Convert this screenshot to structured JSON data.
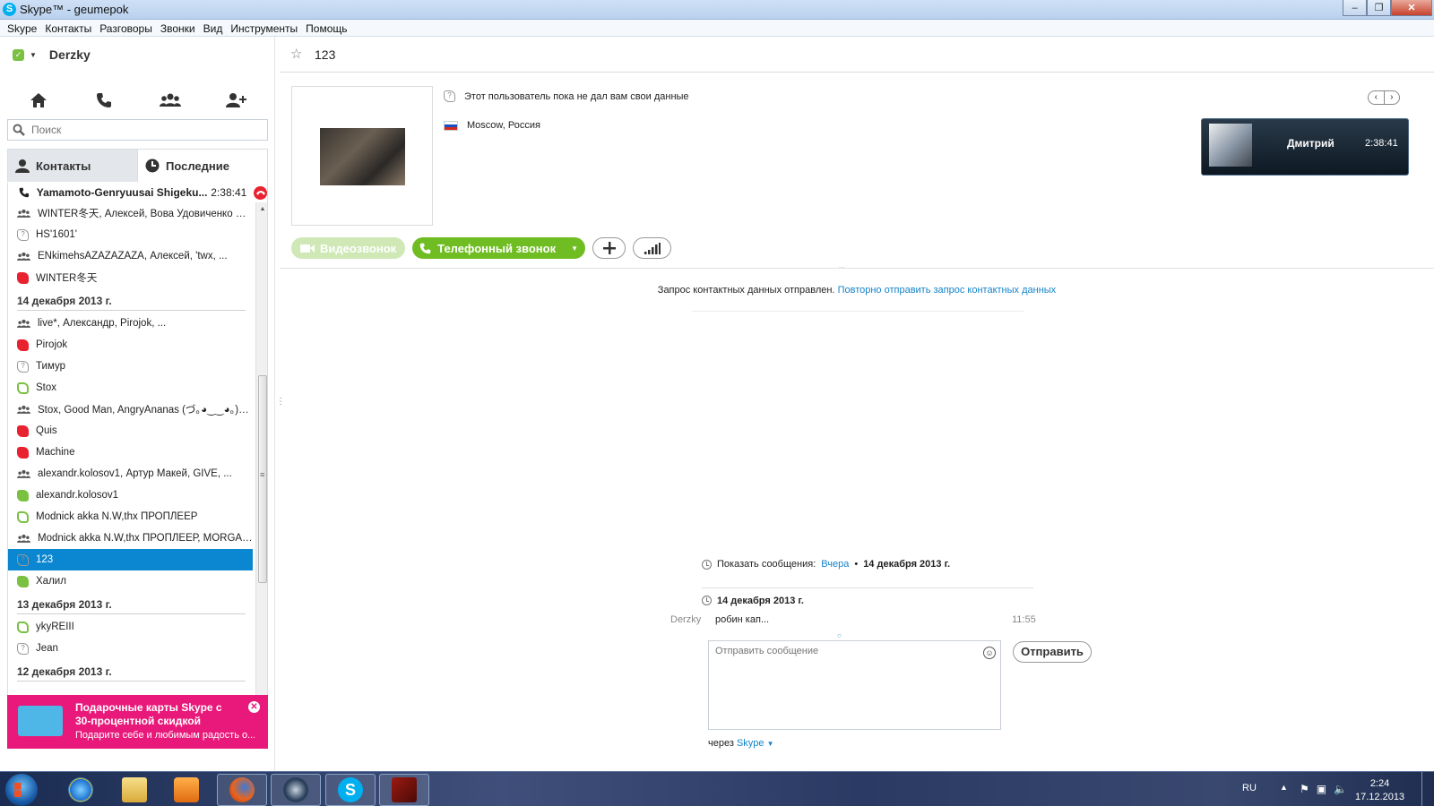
{
  "window": {
    "title": "Skype™ - geumepok",
    "min": "–",
    "max": "❐",
    "close": "✕"
  },
  "menu": [
    "Skype",
    "Контакты",
    "Разговоры",
    "Звонки",
    "Вид",
    "Инструменты",
    "Помощь"
  ],
  "profile": {
    "name": "Derzky"
  },
  "search": {
    "placeholder": "Поиск"
  },
  "tabs": {
    "contacts": "Контакты",
    "recent": "Последние"
  },
  "active_call": {
    "name": "Yamamoto-Genryuusai Shigeku...",
    "time": "2:38:41"
  },
  "recent_list": [
    {
      "type": "group",
      "label": "WINTER冬天, Алексей, Вова Удовиченко Whi..."
    },
    {
      "type": "unknown",
      "label": "HS'1601'"
    },
    {
      "type": "group",
      "label": "ENkimehsAZAZAZAZA, Алексей, 'twx, ..."
    },
    {
      "type": "red",
      "label": "WINTER冬天"
    },
    {
      "type": "date",
      "label": "14 декабря 2013 г."
    },
    {
      "type": "group",
      "label": "live*, Александр, Pirojok, ..."
    },
    {
      "type": "red",
      "label": "Pirojok"
    },
    {
      "type": "unknown",
      "label": "Тимур"
    },
    {
      "type": "green-o",
      "label": "Stox"
    },
    {
      "type": "group",
      "label": "Stox, Good Man, AngryAnanas (づ｡◕‿‿◕｡)づ, ..."
    },
    {
      "type": "red",
      "label": "Quis"
    },
    {
      "type": "red",
      "label": "Machine"
    },
    {
      "type": "group",
      "label": "alexandr.kolosov1, Артур Макей, GIVE, ..."
    },
    {
      "type": "green",
      "label": "alexandr.kolosov1"
    },
    {
      "type": "green-o",
      "label": "Modnick akka N.W,thx ПРОПЛЕЕР"
    },
    {
      "type": "group",
      "label": "Modnick akka N.W,thx ПРОПЛЕЕР, MORGAN, p..."
    },
    {
      "type": "unknown",
      "label": "123",
      "selected": true
    },
    {
      "type": "green",
      "label": "Халил"
    },
    {
      "type": "date",
      "label": "13 декабря 2013 г."
    },
    {
      "type": "green-o",
      "label": "ykyREIII"
    },
    {
      "type": "unknown",
      "label": "Jean"
    },
    {
      "type": "date",
      "label": "12 декабря 2013 г."
    }
  ],
  "promo": {
    "title": "Подарочные карты Skype с 30-процентной скидкой",
    "subtitle": "Подарите себе и любимым радость о..."
  },
  "chat": {
    "title": "123",
    "info_unknown": "Этот пользователь пока не дал вам свои данные",
    "location": "Moscow, Россия",
    "pager": {
      "prev": "‹",
      "next": "›"
    },
    "call_card": {
      "name": "Дмитрий",
      "time": "2:38:41"
    },
    "buttons": {
      "video": "Видеозвонок",
      "phone": "Телефонный звонок"
    },
    "dots": "...",
    "request_note": "Запрос контактных данных отправлен.",
    "request_link": "Повторно отправить запрос контактных данных",
    "history": {
      "label": "Показать сообщения:",
      "yesterday": "Вчера",
      "bullet": "•",
      "date": "14 декабря 2013 г."
    },
    "day_header": "14 декабря 2013 г.",
    "message": {
      "sender": "Derzky",
      "text": "робин кап...",
      "time": "11:55"
    },
    "composer_placeholder": "Отправить сообщение",
    "send": "Отправить",
    "via": "через",
    "via_link": "Skype"
  },
  "taskbar": {
    "lang": "RU",
    "time": "2:24",
    "date": "17.12.2013"
  },
  "colors": {
    "accent": "#00aff0",
    "selected": "#0b86d0",
    "call_green": "#6fbd22",
    "promo": "#e8197a",
    "link": "#1583c9"
  }
}
